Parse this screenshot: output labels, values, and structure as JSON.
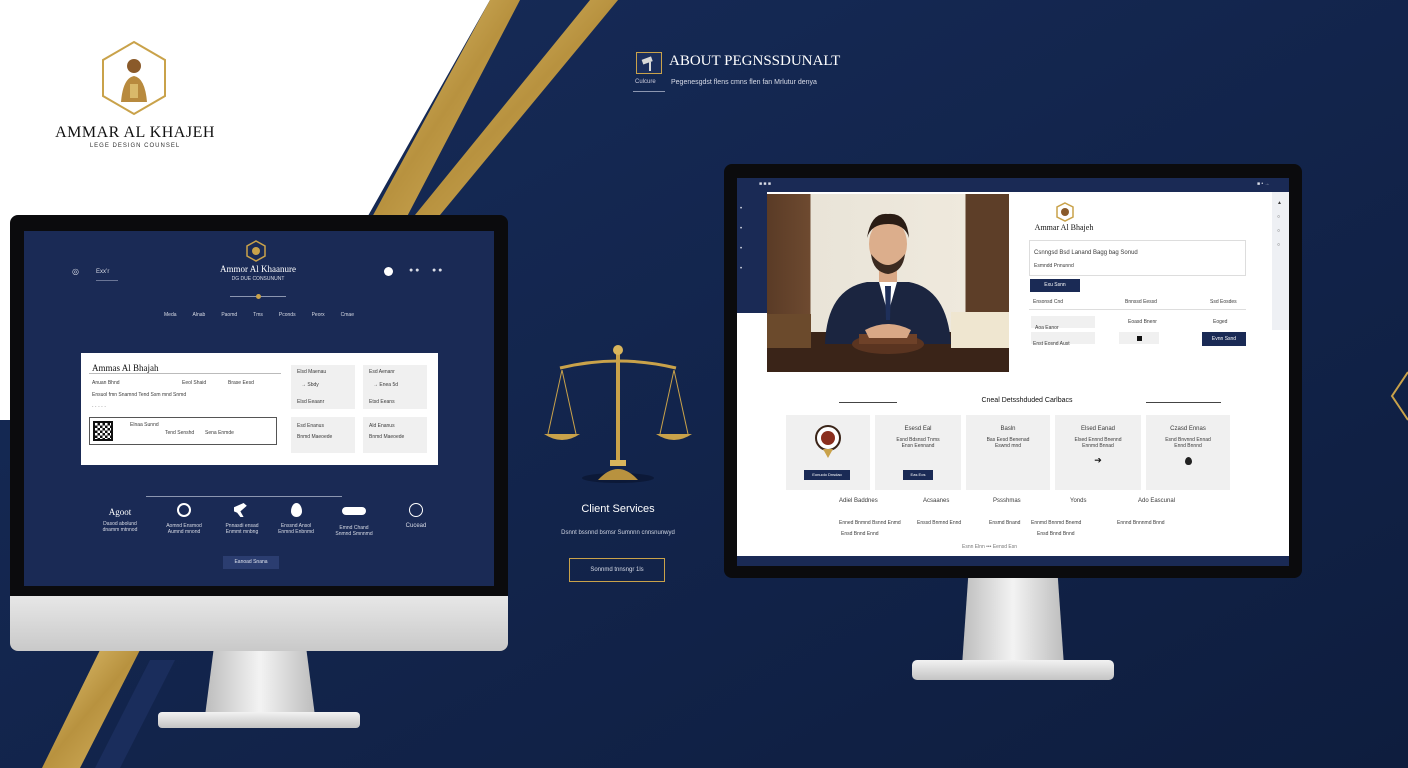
{
  "brand": {
    "name": "AMMAR AL KHAJEH",
    "tagline": "LEGE DESIGN COUNSEL"
  },
  "about": {
    "title": "ABOUT PEGNSSDUNALT",
    "sub_label": "Culcure",
    "subtitle": "Pegenesgdst flens cmns flen fan Mrlutur denya"
  },
  "center": {
    "services_title": "Client Services",
    "services_sub": "Dsnnt bssnnd bsmsr Sumnnn cnnsnunwyd",
    "services_button": "Sonnmd tnnsngr 1ls"
  },
  "left_screen": {
    "menu_items": [
      "◎",
      "Exx’r"
    ],
    "logo_title": "Ammor Al Khaanure",
    "logo_sub": "DG DUE CONSUNUNT",
    "nav": [
      "Meda",
      "Alnab",
      "Paomd",
      "Tms",
      "Pconds",
      "Peorx",
      "Cmae"
    ],
    "card": {
      "title": "Ammas Al Bhajah",
      "row1": [
        "Anuan Bhnd",
        "Eeol Shaid",
        "Brase Eesd"
      ],
      "row2": "Ensuol fmn Snamnd Tend Ssm mnd Snmd",
      "qr_lines": [
        "Elnaa Sunnd",
        "Tend Senshd",
        "Sena Enmde"
      ]
    },
    "side_cards": [
      {
        "line1": "Elsd Maenau",
        "line2": "→ Sbdy",
        "line3": "Elsd Eeaanr"
      },
      {
        "line1": "Esd Aenanr",
        "line2": "→ Enea 5d",
        "line3": "Etsd Eeans"
      },
      {
        "line1": "Esd Enanus",
        "line2": "Bnmd Maeoede"
      },
      {
        "line1": "Ald Enanus",
        "line2": "Bnmd Maeoede"
      }
    ],
    "features": [
      {
        "title": "Agoot",
        "d1": "Dasod abolund",
        "d2": "dnamm mtnnod"
      },
      {
        "title": "",
        "d1": "Aomnd Ensmod",
        "d2": "Aumnd mnond"
      },
      {
        "title": "",
        "d1": "Pnnasdi ensad",
        "d2": "Enmmt mnbng"
      },
      {
        "title": "",
        "d1": "Enssnd Ansol",
        "d2": "Enmnd Enbnmd"
      },
      {
        "title": "",
        "d1": "Emnd Chand",
        "d2": "Snmnd Smnnmd"
      },
      {
        "title": "Cucead",
        "d1": "",
        "d2": ""
      }
    ],
    "button": "Eanoad Snana"
  },
  "right_screen": {
    "topbar_left": "■ ■ ■",
    "topbar_right": "■ • →",
    "side_icons": [
      "•",
      "•",
      "•",
      "•"
    ],
    "name": "Ammar Al Bhajeh",
    "intro_line1": "Csnngsd Bsd Lanand Bagg bag Sonud",
    "intro_line2": "Esmndd Pnnunnd",
    "intro_button": "Exu Ssnn",
    "grid_headers": [
      "Ensonsd Cnd",
      "Bnnssd Eessd",
      "Ssd Eosdes"
    ],
    "grid_cells": [
      "Aoa Eanor",
      "Eoasd Bnenr",
      "Eoged"
    ],
    "grid_row2": [
      "Enst Eosnd Aust"
    ],
    "grid_button": "Evnn Ssnd",
    "section_title": "Cneal Detsshduded Carlbacs",
    "service_cards": [
      {
        "title": "",
        "l1": "",
        "l2": "",
        "btn": "Eonuolo Dnsdao"
      },
      {
        "title": "Esesd Eal",
        "l1": "Esnd Bdsnsd Tnms",
        "l2": "Ensn Eennand",
        "btn": "Eas Eos"
      },
      {
        "title": "Basln",
        "l1": "Bas Eesd Benenad",
        "l2": "Eswnd mnd",
        "btn": ""
      },
      {
        "title": "Elsed Eanad",
        "l1": "Elsed Ennnd Bnennd",
        "l2": "Ennmd Bnnad",
        "btn": ""
      },
      {
        "title": "Czasd Ennas",
        "l1": "Esnd Bnvnnd Ennad",
        "l2": "Ennd Bnnnd",
        "btn": ""
      }
    ],
    "service_labels": [
      "Adiel Baddnes",
      "Acsaanes",
      "Pssshmas",
      "Yonds",
      "Ado Eascunal"
    ],
    "service_descs": [
      "Enned Bnmnd Bsnnd Enmd",
      "Enssd Bnmnd Ennd",
      "Ensmd Bnand",
      "Ennmd Bnnmd Bnemd",
      "Ennnd Bnnnmd Bnnd"
    ],
    "service_descs2": [
      "Ensd Bnnd Ennd",
      "Ensd Bnnd Bnnd"
    ],
    "pager": "Esnn Elnn  •••  Eensd Esn"
  },
  "colors": {
    "navy": "#12244a",
    "gold": "#c9a24a",
    "white": "#ffffff"
  },
  "icons": [
    "scales-icon",
    "gavel-icon",
    "pin-icon",
    "handshake-icon",
    "qr-icon",
    "emblem-icon"
  ]
}
